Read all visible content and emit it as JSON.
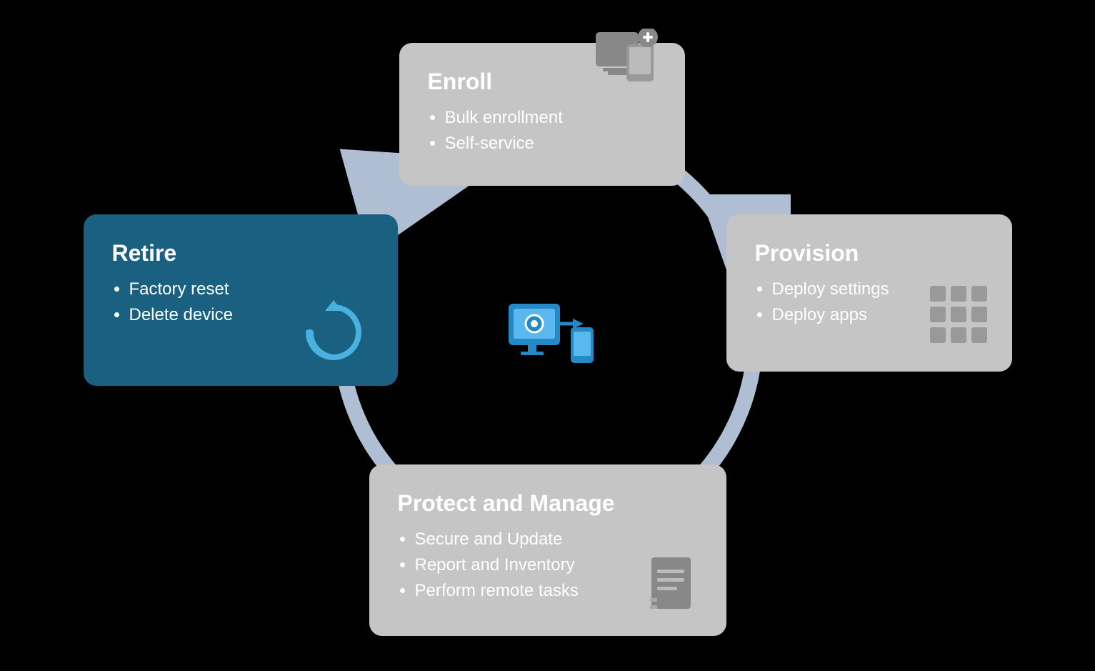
{
  "cards": {
    "enroll": {
      "title": "Enroll",
      "items": [
        "Bulk enrollment",
        "Self-service"
      ]
    },
    "provision": {
      "title": "Provision",
      "items": [
        "Deploy settings",
        "Deploy apps"
      ]
    },
    "protect": {
      "title": "Protect and Manage",
      "items": [
        "Secure and Update",
        "Report and Inventory",
        "Perform remote tasks"
      ]
    },
    "retire": {
      "title": "Retire",
      "items": [
        "Factory reset",
        "Delete device"
      ]
    }
  },
  "colors": {
    "card_bg": "#c5c5c5",
    "retire_bg": "#1a6080",
    "circle": "#b0bed4",
    "center_blue": "#2489c5"
  }
}
